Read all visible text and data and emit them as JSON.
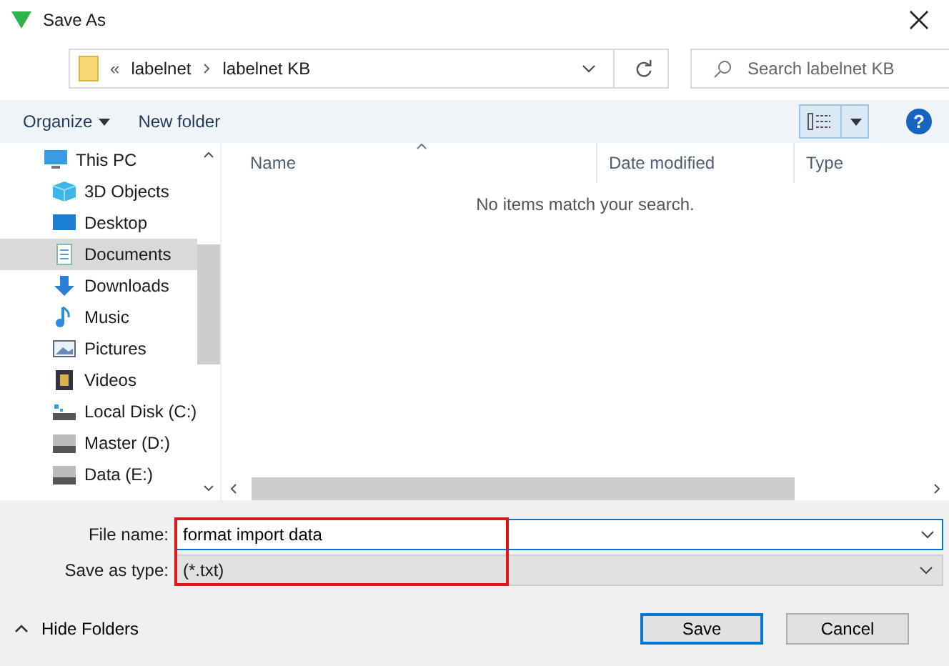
{
  "window": {
    "title": "Save As"
  },
  "address_bar": {
    "overflow_glyph": "«",
    "path": [
      "labelnet",
      "labelnet KB"
    ]
  },
  "search": {
    "placeholder": "Search labelnet KB"
  },
  "toolbar": {
    "organize": "Organize",
    "new_folder": "New folder"
  },
  "sidebar": {
    "items": [
      {
        "label": "This PC",
        "kind": "pc",
        "selected": false,
        "children": [
          {
            "label": "3D Objects",
            "kind": "cube",
            "selected": false
          },
          {
            "label": "Desktop",
            "kind": "desktop",
            "selected": false
          },
          {
            "label": "Documents",
            "kind": "documents",
            "selected": true
          },
          {
            "label": "Downloads",
            "kind": "downloads",
            "selected": false
          },
          {
            "label": "Music",
            "kind": "music",
            "selected": false
          },
          {
            "label": "Pictures",
            "kind": "pictures",
            "selected": false
          },
          {
            "label": "Videos",
            "kind": "videos",
            "selected": false
          },
          {
            "label": "Local Disk (C:)",
            "kind": "system-drive",
            "selected": false
          },
          {
            "label": "Master (D:)",
            "kind": "drive",
            "selected": false
          },
          {
            "label": "Data (E:)",
            "kind": "drive",
            "selected": false
          }
        ]
      }
    ]
  },
  "file_list": {
    "columns": [
      "Name",
      "Date modified",
      "Type"
    ],
    "empty_message": "No items match your search."
  },
  "file_name": {
    "label": "File name:",
    "value": "format import data"
  },
  "save_as_type": {
    "label": "Save as type:",
    "value": "(*.txt)"
  },
  "hide_folders": "Hide Folders",
  "buttons": {
    "save": "Save",
    "cancel": "Cancel"
  },
  "help": {
    "glyph": "?"
  }
}
